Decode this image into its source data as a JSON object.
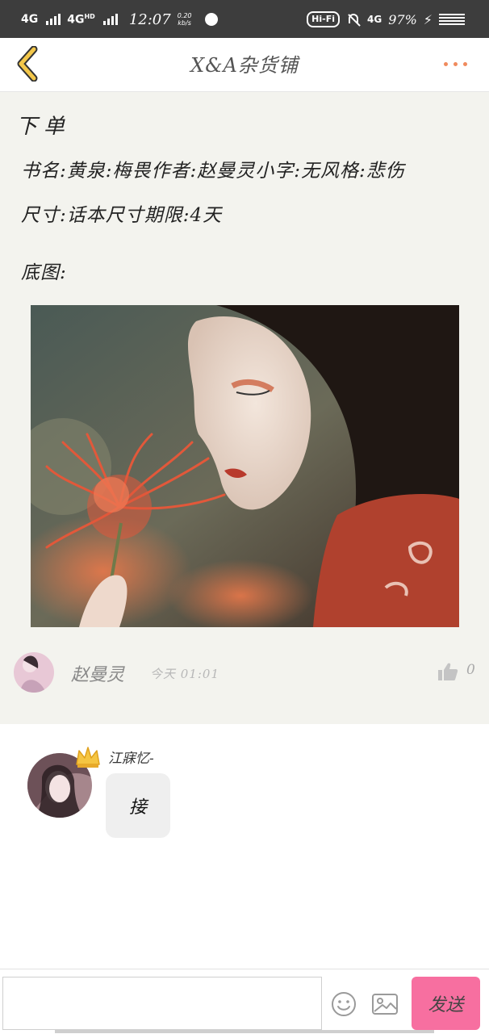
{
  "status_bar": {
    "network_1": "4G",
    "network_2": "4G",
    "network_2_sup": "HD",
    "time": "12:07",
    "speed_value": "0.20",
    "speed_unit": "kb/s",
    "hifi": "Hi-Fi",
    "network_3": "4G",
    "battery": "97%",
    "charging_icon": "bolt-icon"
  },
  "header": {
    "back_icon": "chevron-left-icon",
    "title": "X&A杂货铺",
    "more_icon": "more-dots-icon",
    "accent_color": "#f08a5d",
    "back_color": "#f3c74a"
  },
  "post": {
    "title": "下单",
    "line1": "书名:黄泉:梅畏作者:赵曼灵小字:无风格:悲伤",
    "line2": "尺寸:话本尺寸期限:4天",
    "line3": "底图:",
    "image_alt": "photo",
    "author_name": "赵曼灵",
    "time": "今天 01:01",
    "like_icon": "thumbs-up-icon",
    "like_count": "0",
    "background": "#f3f3ee"
  },
  "comment": {
    "user_name": "江寐忆-",
    "crown_icon": "crown-icon",
    "message": "接"
  },
  "composer": {
    "input_placeholder": "",
    "emoji_icon": "smiley-icon",
    "image_icon": "image-icon",
    "send_label": "发送",
    "send_color": "#f76fa0"
  }
}
